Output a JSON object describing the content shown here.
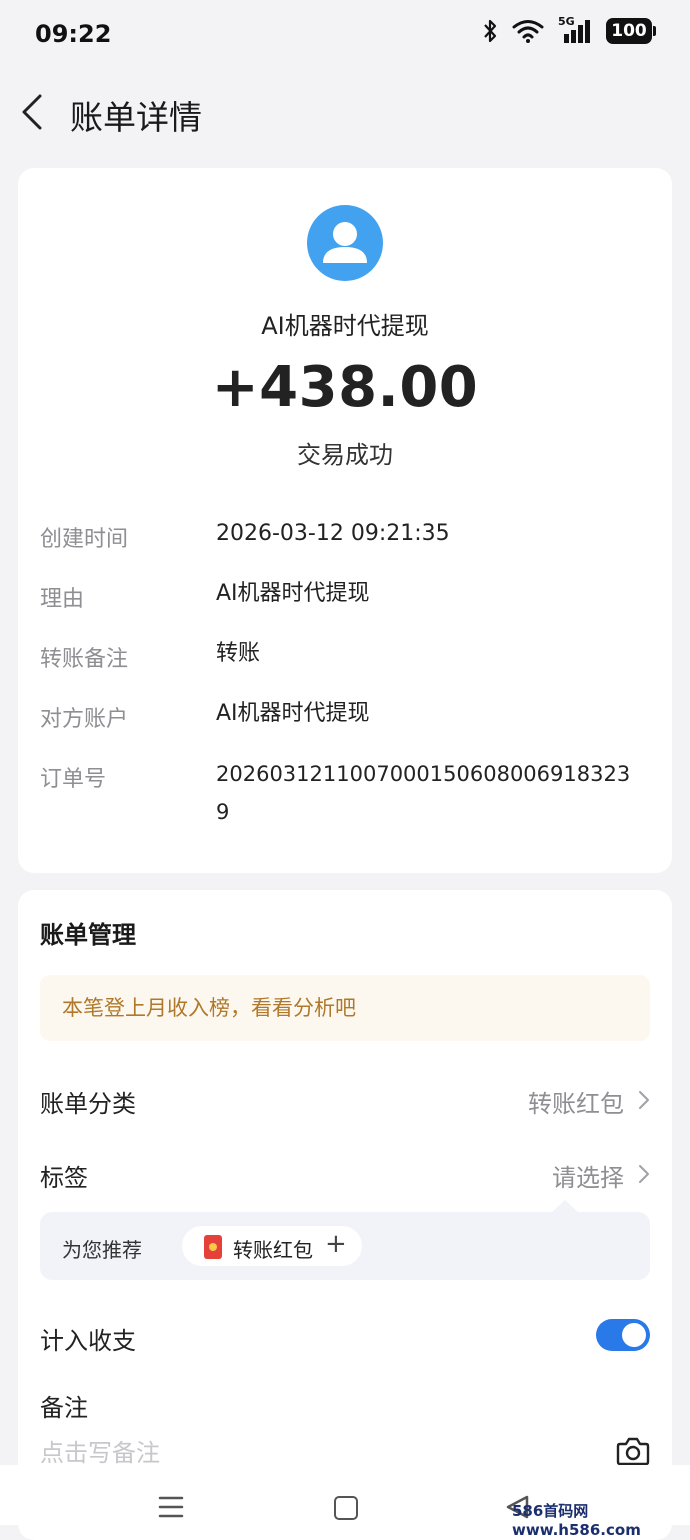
{
  "status_bar": {
    "time": "09:22",
    "network": "5G",
    "battery": "100",
    "icons": [
      "bluetooth-icon",
      "wifi-icon",
      "signal-icon",
      "battery-icon"
    ]
  },
  "nav": {
    "title": "账单详情"
  },
  "transaction": {
    "merchant": "AI机器时代提现",
    "amount": "+438.00",
    "status": "交易成功",
    "details": [
      {
        "label": "创建时间",
        "value": "2026-03-12 09:21:35"
      },
      {
        "label": "理由",
        "value": "AI机器时代提现"
      },
      {
        "label": "转账备注",
        "value": "转账"
      },
      {
        "label": "对方账户",
        "value": "AI机器时代提现"
      },
      {
        "label": "订单号",
        "value": "20260312110070001506080069183239"
      }
    ]
  },
  "manage": {
    "title": "账单管理",
    "tip": "本笔登上月收入榜，看看分析吧",
    "category": {
      "label": "账单分类",
      "value": "转账红包"
    },
    "tag": {
      "label": "标签",
      "value": "请选择"
    },
    "recommend": {
      "label": "为您推荐",
      "chip_label": "转账红包",
      "chip_plus": "+"
    },
    "include": {
      "label": "计入收支",
      "on": true
    },
    "remark": {
      "label": "备注",
      "placeholder": "点击写备注"
    }
  },
  "colors": {
    "accent": "#2979e8",
    "avatar": "#43a2f0",
    "tip_text": "#b0782b",
    "tip_bg": "#fdf8ef"
  },
  "watermark": "586首码网 www.h586.com"
}
